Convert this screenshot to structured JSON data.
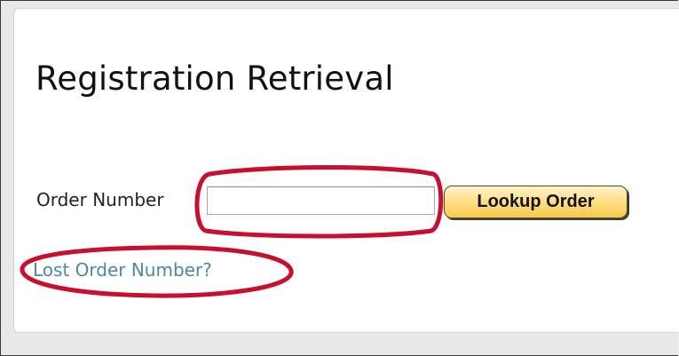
{
  "page": {
    "title": "Registration Retrieval"
  },
  "form": {
    "order_label": "Order Number",
    "order_value": "",
    "order_placeholder": "",
    "lookup_button_label": "Lookup Order",
    "lost_link_text": "Lost Order Number?"
  },
  "colors": {
    "annotation_circle": "#c8102e",
    "link": "#4a8a9a",
    "button_gradient_top": "#fff4cc",
    "button_gradient_bottom": "#f9c94a"
  }
}
